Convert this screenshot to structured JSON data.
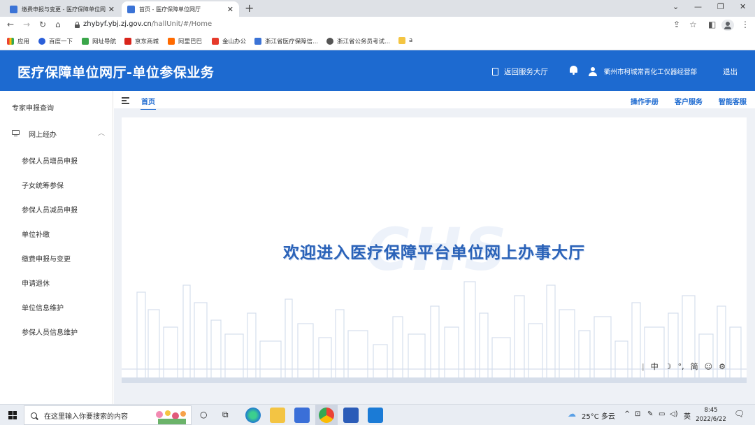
{
  "browser": {
    "tabs": [
      {
        "title": "缴费申报与变更 - 医疗保障单位网",
        "active": false
      },
      {
        "title": "首页 - 医疗保障单位网厅",
        "active": true
      }
    ],
    "new_tab_icon": "plus-icon",
    "url_host": "zhybyf.ybj.zj.gov.cn",
    "url_path": "/hallUnit/#/Home",
    "bookmarks": [
      "应用",
      "百度一下",
      "网址导航",
      "京东商城",
      "阿里巴巴",
      "金山办公",
      "浙江省医疗保障信...",
      "浙江省公务员考试...",
      "a"
    ]
  },
  "header": {
    "title": "医疗保障单位网厅-单位参保业务",
    "return_label": "返回服务大厅",
    "user_name": "衢州市柯城常青化工仪器经营部",
    "logout_label": "退出",
    "brand_color": "#1d6ad0"
  },
  "sidebar": {
    "top_item": "专家申报查询",
    "group_label": "网上经办",
    "items": [
      "参保人员增员申报",
      "子女统筹参保",
      "参保人员减员申报",
      "单位补缴",
      "缴费申报与变更",
      "申请退休",
      "单位信息维护",
      "参保人员信息维护"
    ]
  },
  "tabstrip": {
    "home_tab": "首页",
    "links": [
      "操作手册",
      "客户服务",
      "智能客服"
    ]
  },
  "main": {
    "welcome": "欢迎进入医疗保障平台单位网上办事大厅",
    "watermark": "CHS"
  },
  "ime": [
    "中",
    "☽",
    "°,",
    "简",
    "☺",
    "⚙"
  ],
  "taskbar": {
    "search_placeholder": "在这里输入你要搜索的内容",
    "weather": "25°C 多云",
    "lang": "英",
    "time": "8:45",
    "date": "2022/6/22"
  }
}
